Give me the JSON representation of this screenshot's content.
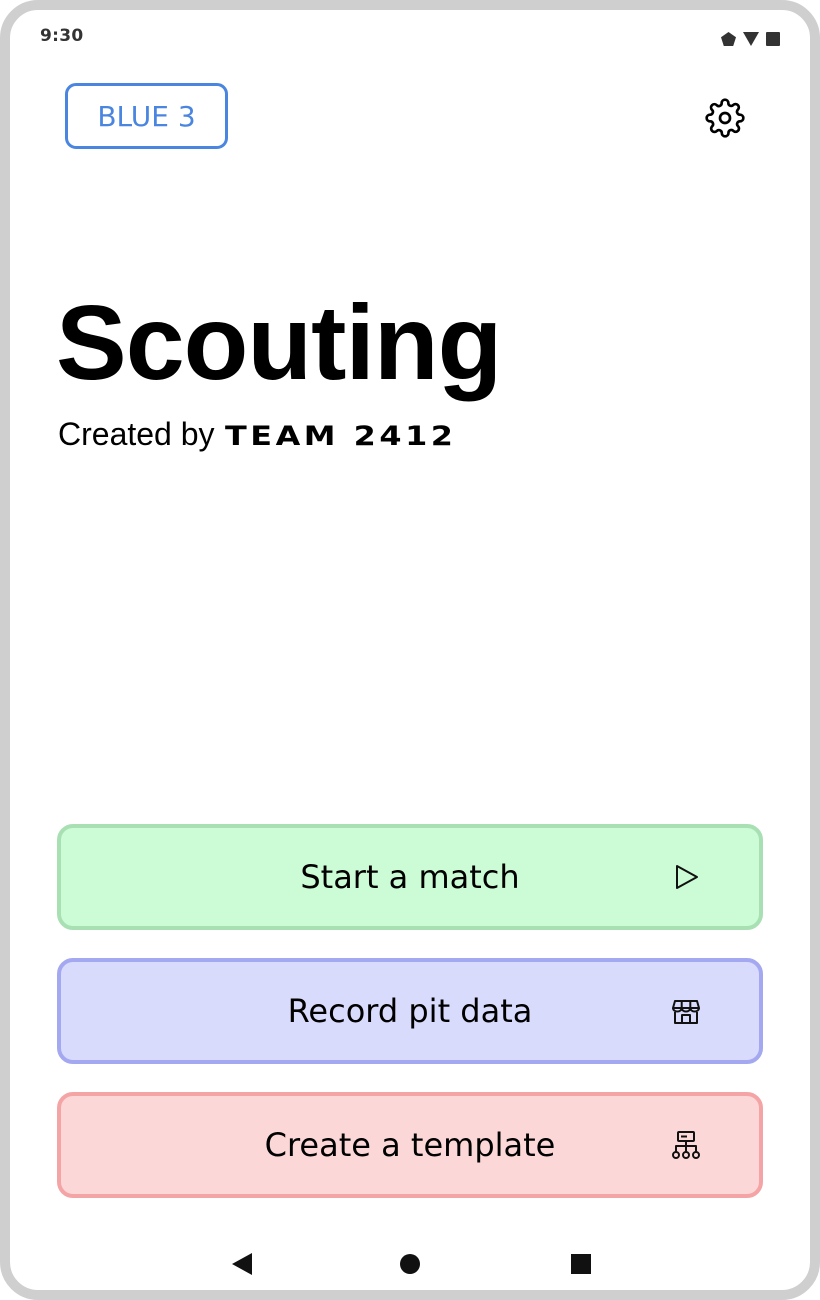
{
  "status_bar": {
    "time": "9:30",
    "icons": [
      "signal-icon",
      "wifi-icon",
      "battery-icon"
    ]
  },
  "header": {
    "alliance_label": "BLUE 3",
    "alliance_color": "#4a86e0",
    "settings_icon": "gear-icon"
  },
  "hero": {
    "title": "Scouting",
    "subtitle_prefix": "Created by",
    "subtitle_team": "TEAM 2412"
  },
  "actions": [
    {
      "label": "Start a match",
      "icon": "play-icon",
      "background": "#ccfcd5",
      "border": "#a8e0b4"
    },
    {
      "label": "Record pit data",
      "icon": "storefront-icon",
      "background": "#d9dbfd",
      "border": "#a3a8f0"
    },
    {
      "label": "Create a template",
      "icon": "sitemap-icon",
      "background": "#fcd7d8",
      "border": "#f5a4a6"
    }
  ],
  "nav_bar": {
    "buttons": [
      "back-icon",
      "home-icon",
      "recents-icon"
    ]
  }
}
